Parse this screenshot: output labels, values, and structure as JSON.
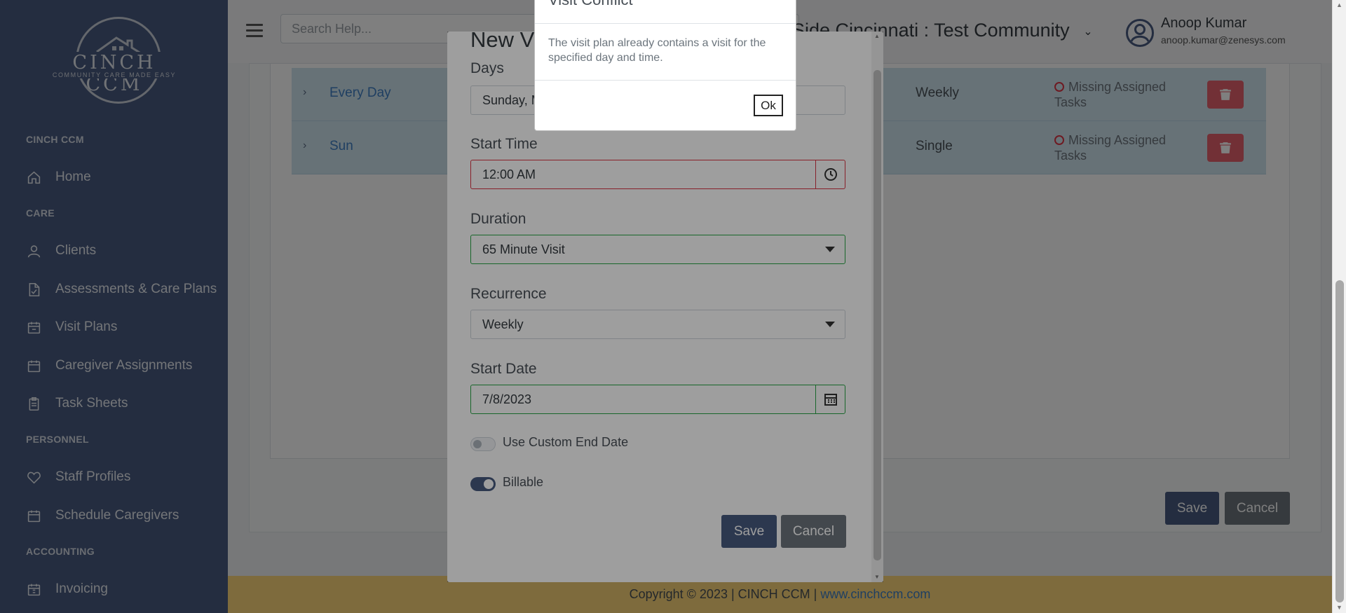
{
  "sidebar": {
    "logo": {
      "brand": "CINCH CCM",
      "tagline": "COMMUNITY CARE MADE EASY"
    },
    "sections": [
      {
        "label": "CINCH CCM"
      },
      {
        "label": "CARE"
      },
      {
        "label": "PERSONNEL"
      },
      {
        "label": "ACCOUNTING"
      }
    ],
    "items": [
      {
        "label": "Home",
        "icon": "home-icon"
      },
      {
        "label": "Clients",
        "icon": "user-icon"
      },
      {
        "label": "Assessments & Care Plans",
        "icon": "file-icon"
      },
      {
        "label": "Visit Plans",
        "icon": "calendar-plan-icon"
      },
      {
        "label": "Caregiver Assignments",
        "icon": "calendar-icon"
      },
      {
        "label": "Task Sheets",
        "icon": "clipboard-icon"
      },
      {
        "label": "Staff Profiles",
        "icon": "heart-icon"
      },
      {
        "label": "Schedule Caregivers",
        "icon": "calendar-icon"
      },
      {
        "label": "Invoicing",
        "icon": "invoice-icon"
      }
    ]
  },
  "header": {
    "search_placeholder": "Search Help...",
    "community": "Side Cincinnati : Test Community",
    "user": {
      "name": "Anoop Kumar",
      "email": "anoop.kumar@zenesys.com"
    }
  },
  "visits": [
    {
      "name": "Every Day",
      "recurrence": "Weekly",
      "status": "Missing Assigned Tasks"
    },
    {
      "name": "Sun",
      "recurrence": "Single",
      "status": "Missing Assigned Tasks"
    }
  ],
  "page_actions": {
    "save": "Save",
    "cancel": "Cancel"
  },
  "modal": {
    "title": "New V",
    "days": {
      "label": "Days",
      "value": "Sunday, M"
    },
    "start_time": {
      "label": "Start Time",
      "value": "12:00 AM"
    },
    "duration": {
      "label": "Duration",
      "value": "65 Minute Visit"
    },
    "recurrence": {
      "label": "Recurrence",
      "value": "Weekly"
    },
    "start_date": {
      "label": "Start Date",
      "value": "7/8/2023"
    },
    "custom_end": {
      "label": "Use Custom End Date",
      "on": false
    },
    "billable": {
      "label": "Billable",
      "on": true
    },
    "save": "Save",
    "cancel": "Cancel"
  },
  "dialog": {
    "title": "Visit Conflict",
    "body": "The visit plan already contains a visit for the specified day and time.",
    "ok": "Ok"
  },
  "footer": {
    "text": "Copyright © 2023 | CINCH CCM | ",
    "link": "www.cinchccm.com"
  },
  "colors": {
    "sidebar": "#485b80",
    "accent": "#485b80",
    "row": "#cfe4ef",
    "danger": "#e4606d",
    "footer": "#fcd77a"
  }
}
